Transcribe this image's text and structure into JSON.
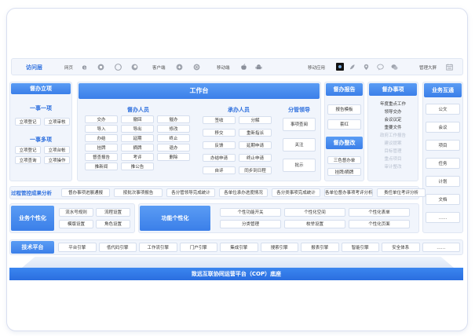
{
  "topbar": {
    "brand": "访问层",
    "web_label": "网页",
    "client_label": "客户端",
    "mobile_label": "移动端",
    "mobile_app_label": "移动应用",
    "big_screen_label": "管理大屏"
  },
  "top_boxes": {
    "duban_lixiang": "督办立项",
    "yishi_yixiang": "一事一项",
    "yishi_yixiang_items": [
      "立项登记",
      "立项审核"
    ],
    "yishi_duoxiang": "一事多项",
    "yishi_duoxiang_items": [
      "立项登记",
      "立项台帐",
      "立项查询",
      "立项操作"
    ],
    "workbench": "工作台",
    "duban_renyuan": "督办人员",
    "duban_renyuan_items": [
      "交办",
      "撤回",
      "催办",
      "导入",
      "导出",
      "修改",
      "办结",
      "延期",
      "终止",
      "挂牌",
      "摘牌",
      "退办",
      "督查报告",
      "考评",
      "删除",
      "推新闻",
      "推公告"
    ],
    "chengban_renyuan": "承办人员",
    "chengban_renyuan_items": [
      "签收",
      "分解",
      "移交",
      "重新指派",
      "反馈",
      "延期申请",
      "办结申请",
      "终止申请",
      "自评",
      "同步到日程"
    ],
    "fenguan_lingdao": "分管领导",
    "fenguan_lingdao_items": [
      "事项查阅",
      "关注",
      "批示"
    ],
    "duban_baogao": "督办报告",
    "duban_baogao_items": [
      "报告模板",
      "套红"
    ],
    "duban_zhenggai": "督办整改",
    "duban_zhenggai_items": [
      "三色督办单",
      "挂牌/摘牌"
    ],
    "duban_shixiang": "督办事项",
    "duban_shixiang_items": [
      "年度重点工作",
      "领导交办",
      "会议议定",
      "重要文件"
    ],
    "duban_shixiang_faded": [
      "政府工作报告",
      "建议提案",
      "目标管理",
      "重点项目",
      "审计整改"
    ],
    "yewu_hutong": "业务互通",
    "yewu_hutong_items": [
      "公文",
      "会议",
      "项目",
      "任务",
      "计划",
      "文档",
      "……"
    ]
  },
  "process_row": {
    "title": "过程管控成果分析",
    "items": [
      "督办事项进展通报",
      "按批次事项报告",
      "各分管领导完成统计",
      "各单位承办进度情况",
      "各分类事项完成统计",
      "各单位督办事项考评分析",
      "责任单位考评分析"
    ]
  },
  "business_row": {
    "title": "业务个性化",
    "items": [
      "流水号规则",
      "流程设置",
      "模版设置",
      "角色设置"
    ],
    "func_title": "功能个性化",
    "func_items": [
      "个性功能开关",
      "个性化空间",
      "个性化表单",
      "分类管理",
      "枚举设置",
      "个性化页面"
    ]
  },
  "tech_row": {
    "title": "技术平台",
    "items": [
      "平台引擎",
      "低代码引擎",
      "工作流引擎",
      "门户引擎",
      "集成引擎",
      "搜索引擎",
      "报表引擎",
      "智能引擎",
      "安全体系",
      "……"
    ]
  },
  "base_platform": "致远互联协同运营平台（COP）底座",
  "colors": {
    "primary": "#3b7fe9",
    "title_blue": "#2d6fde",
    "panel": "#f1f5fc"
  }
}
